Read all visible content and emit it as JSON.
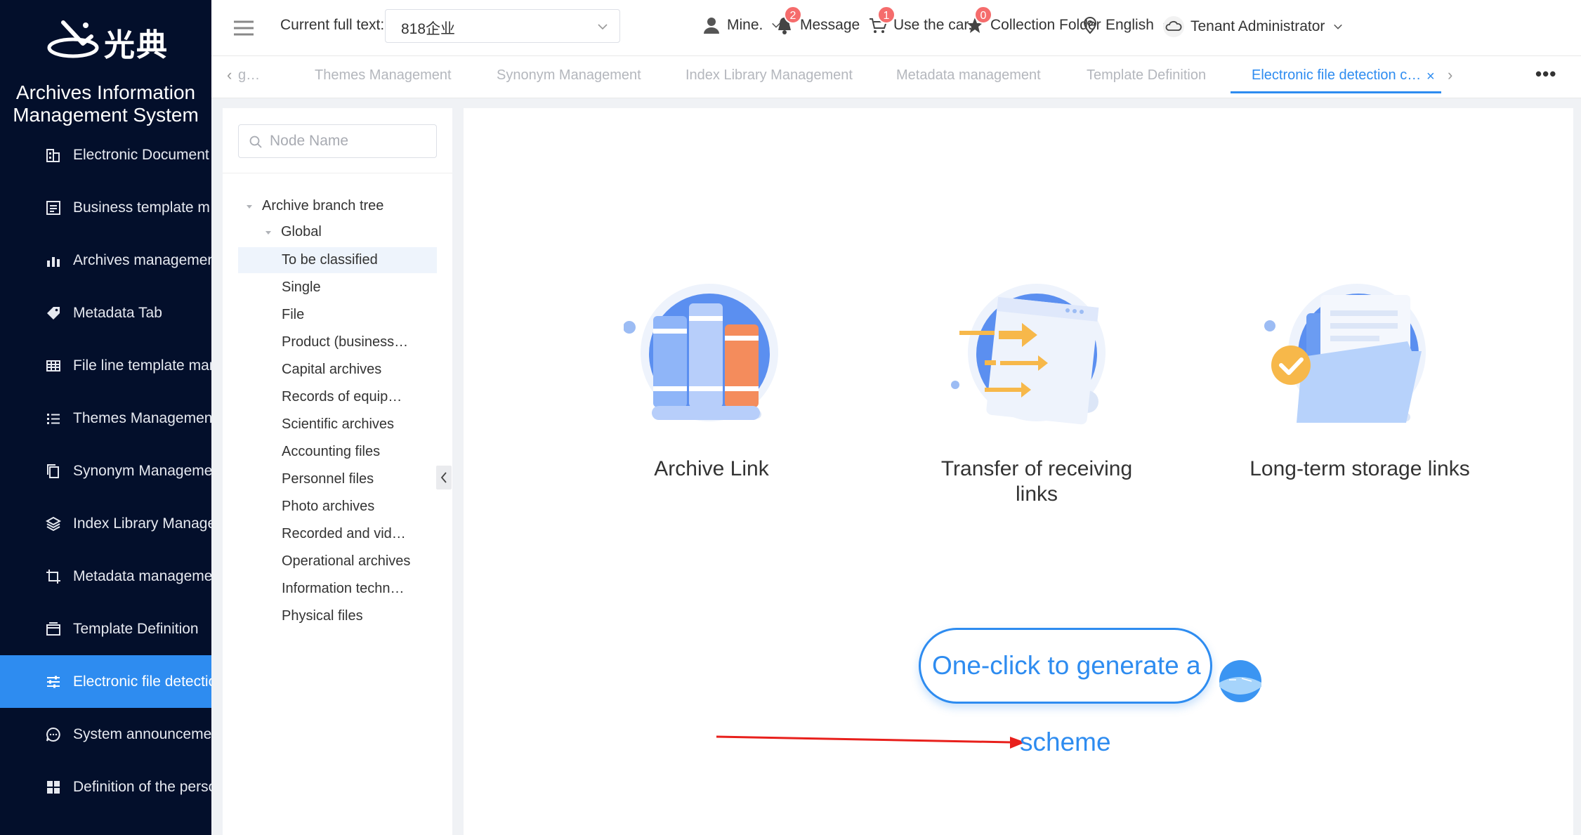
{
  "app": {
    "logo_text": "光典",
    "system_title": "Archives Information Management System"
  },
  "sidebar": {
    "items": [
      {
        "label": "Electronic Document",
        "icon": "building-icon"
      },
      {
        "label": "Business template m",
        "icon": "template-icon"
      },
      {
        "label": "Archives managemen",
        "icon": "bar-chart-icon"
      },
      {
        "label": "Metadata Tab",
        "icon": "tag-icon"
      },
      {
        "label": "File line template man",
        "icon": "table-icon"
      },
      {
        "label": "Themes Management",
        "icon": "list-icon"
      },
      {
        "label": "Synonym Manageme",
        "icon": "copy-icon"
      },
      {
        "label": "Index Library Manage",
        "icon": "layers-icon"
      },
      {
        "label": "Metadata manageme",
        "icon": "crop-icon"
      },
      {
        "label": "Template Definition",
        "icon": "window-icon"
      },
      {
        "label": "Electronic file detectio",
        "icon": "sliders-icon",
        "active": true
      },
      {
        "label": "System announceme",
        "icon": "chat-icon"
      },
      {
        "label": "Definition of the perso",
        "icon": "grid-icon"
      }
    ]
  },
  "header": {
    "current_label": "Current full text:",
    "current_value": "818企业",
    "mine_label": "Mine.",
    "message_label": "Message",
    "message_count": "2",
    "cart_label": "Use the car.",
    "cart_count": "1",
    "collection_label": "Collection Folder",
    "collection_count": "0",
    "language_label": "English",
    "user_label": "Tenant Administrator"
  },
  "tabs": {
    "partial": "g…",
    "items": [
      {
        "label": "Themes Management"
      },
      {
        "label": "Synonym Management"
      },
      {
        "label": "Index Library Management"
      },
      {
        "label": "Metadata management"
      },
      {
        "label": "Template Definition"
      },
      {
        "label": "Electronic file detection c…",
        "active": true
      }
    ],
    "close_glyph": "×",
    "prev_glyph": "‹",
    "next_glyph": "›",
    "more_glyph": "•••"
  },
  "tree": {
    "search_placeholder": "Node Name",
    "root": "Archive branch tree",
    "global": "Global",
    "children": [
      "To be classified",
      "Single",
      "File",
      "Product (business…",
      "Capital archives",
      "Records of equip…",
      "Scientific archives",
      "Accounting files",
      "Personnel files",
      "Photo archives",
      "Recorded and vid…",
      "Operational archives",
      "Information techn…",
      "Physical files"
    ],
    "selected_index": 0
  },
  "main": {
    "cards": [
      {
        "label": "Archive Link"
      },
      {
        "label": "Transfer of receiving links"
      },
      {
        "label": "Long-term storage links"
      }
    ],
    "generate_button": "One-click to generate a",
    "generate_button_cont": "scheme"
  },
  "colors": {
    "sidebar_bg": "#030f2b",
    "accent": "#2e8cf0",
    "badge": "#f56c6c",
    "annotation_arrow": "#e8201c"
  }
}
